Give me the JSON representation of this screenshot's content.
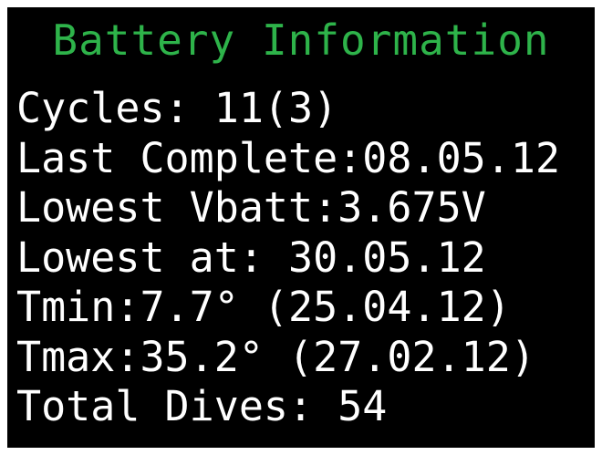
{
  "screen": {
    "title": "Battery Information",
    "title_color": "#2eb34a",
    "text_color": "#ffffff",
    "background_color": "#000000",
    "lines": [
      "Cycles: 11(3)",
      "Last Complete:08.05.12",
      "Lowest Vbatt:3.675V",
      "Lowest at: 30.05.12",
      "Tmin:7.7° (25.04.12)",
      "Tmax:35.2° (27.02.12)",
      "Total Dives: 54"
    ]
  }
}
